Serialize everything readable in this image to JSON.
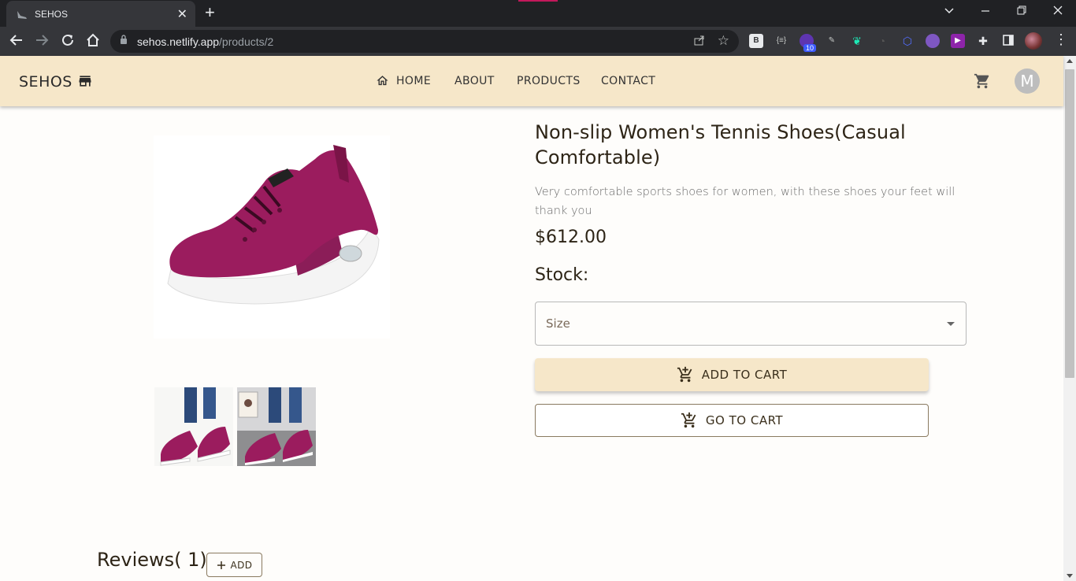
{
  "browser": {
    "tab_title": "SEHOS",
    "url_host": "sehos.netlify.app",
    "url_path": "/products/2",
    "extension_badge": "10"
  },
  "header": {
    "brand": "SEHOS",
    "nav": [
      "HOME",
      "ABOUT",
      "PRODUCTS",
      "CONTACT"
    ],
    "avatar_initial": "M"
  },
  "product": {
    "title": "Non-slip Women's Tennis Shoes(Casual Comfortable)",
    "description": "Very comfortable sports shoes for women, with these shoes your feet will thank you",
    "price": "$612.00",
    "stock_label": "Stock:",
    "size_placeholder": "Size",
    "add_to_cart": "ADD TO CART",
    "go_to_cart": "GO TO CART"
  },
  "reviews": {
    "heading": "Reviews( 1)",
    "add_label": "ADD"
  },
  "colors": {
    "accent": "#f6e7c9",
    "shoe": "#9b1c5e",
    "text": "#2d2416"
  }
}
